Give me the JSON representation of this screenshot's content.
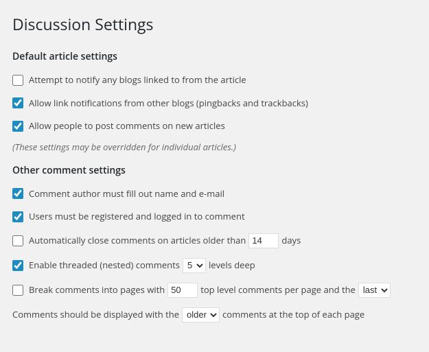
{
  "page_title": "Discussion Settings",
  "section1": {
    "title": "Default article settings",
    "opt_notify": {
      "checked": false,
      "label": "Attempt to notify any blogs linked to from the article"
    },
    "opt_pingback": {
      "checked": true,
      "label": "Allow link notifications from other blogs (pingbacks and trackbacks)"
    },
    "opt_allow_comments": {
      "checked": true,
      "label": "Allow people to post comments on new articles"
    },
    "note": "(These settings may be overridden for individual articles.)"
  },
  "section2": {
    "title": "Other comment settings",
    "opt_name_email": {
      "checked": true,
      "label": "Comment author must fill out name and e-mail"
    },
    "opt_registered": {
      "checked": true,
      "label": "Users must be registered and logged in to comment"
    },
    "opt_auto_close": {
      "checked": false,
      "label_before": "Automatically close comments on articles older than",
      "value": "14",
      "label_after": "days"
    },
    "opt_threaded": {
      "checked": true,
      "label_before": "Enable threaded (nested) comments",
      "value": "5",
      "label_after": "levels deep"
    },
    "opt_paginate": {
      "checked": false,
      "label_a": "Break comments into pages with",
      "per_page": "50",
      "label_b": "top level comments per page and the",
      "default_page": "last",
      "label_c": ""
    },
    "opt_order": {
      "label_a": "Comments should be displayed with the",
      "order": "older",
      "label_b": "comments at the top of each page"
    }
  }
}
